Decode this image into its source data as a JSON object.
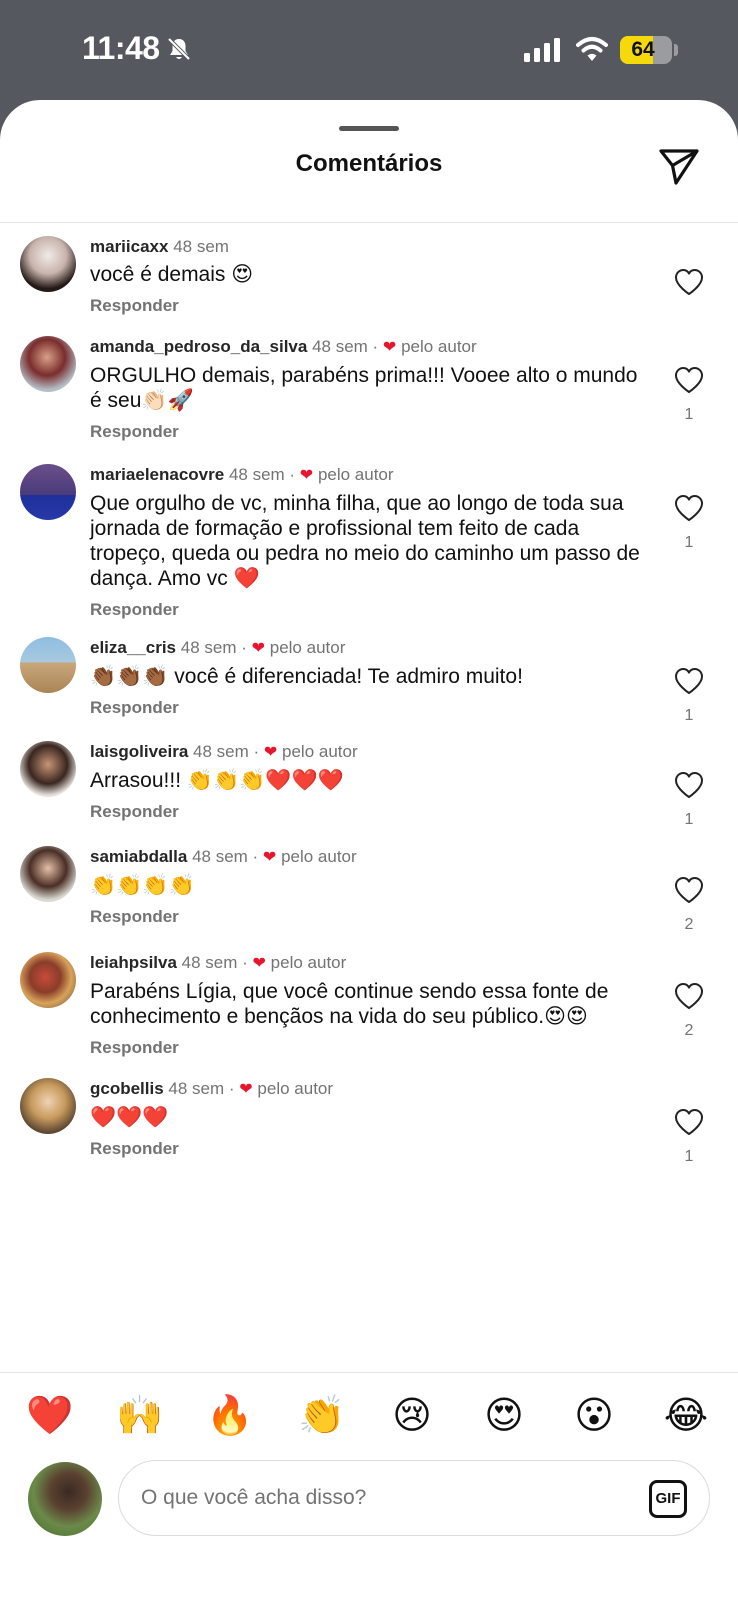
{
  "status_bar": {
    "time": "11:48",
    "battery": "64",
    "battery_level": 0.64
  },
  "header": {
    "title": "Comentários"
  },
  "comments": [
    {
      "username": "mariicaxx",
      "time": "48 sem",
      "liked_by_author": false,
      "author_label": "",
      "text": "você é demais 😍",
      "reply": "Responder",
      "likes": ""
    },
    {
      "username": "amanda_pedroso_da_silva",
      "time": "48 sem",
      "liked_by_author": true,
      "author_label": "pelo autor",
      "text": "ORGULHO demais, parabéns prima!!! Vooee alto o mundo é seu👏🏻🚀",
      "reply": "Responder",
      "likes": "1"
    },
    {
      "username": "mariaelenacovre",
      "time": "48 sem",
      "liked_by_author": true,
      "author_label": "pelo autor",
      "text": "Que orgulho de vc, minha filha, que ao longo de toda sua jornada de formação e profissional tem feito de cada tropeço, queda ou pedra no meio do caminho um passo de dança. Amo vc ❤️",
      "reply": "Responder",
      "likes": "1"
    },
    {
      "username": "eliza__cris",
      "time": "48 sem",
      "liked_by_author": true,
      "author_label": "pelo autor",
      "text": "👏🏾👏🏾👏🏾 você é diferenciada! Te admiro muito!",
      "reply": "Responder",
      "likes": "1"
    },
    {
      "username": "laisgoliveira",
      "time": "48 sem",
      "liked_by_author": true,
      "author_label": "pelo autor",
      "text": "Arrasou!!! 👏👏👏❤️❤️❤️",
      "reply": "Responder",
      "likes": "1"
    },
    {
      "username": "samiabdalla",
      "time": "48 sem",
      "liked_by_author": true,
      "author_label": "pelo autor",
      "text": "👏👏👏👏",
      "reply": "Responder",
      "likes": "2"
    },
    {
      "username": "leiahpsilva",
      "time": "48 sem",
      "liked_by_author": true,
      "author_label": "pelo autor",
      "text": "Parabéns Lígia, que você continue sendo essa fonte de conhecimento e bençãos na vida do seu público.😍😍",
      "reply": "Responder",
      "likes": "2"
    },
    {
      "username": "gcobellis",
      "time": "48 sem",
      "liked_by_author": true,
      "author_label": "pelo autor",
      "text": "❤️❤️❤️",
      "reply": "Responder",
      "likes": "1"
    }
  ],
  "reactions": [
    "❤️",
    "🙌",
    "🔥",
    "👏",
    "😢",
    "😍",
    "😮",
    "😂"
  ],
  "composer": {
    "placeholder": "O que você acha disso?",
    "gif_label": "GIF"
  },
  "colors": {
    "status_bar_bg": "#55595f",
    "author_heart": "#e8152e",
    "battery_yellow": "#f5d90a",
    "meta_gray": "#737373"
  },
  "icons": {
    "status": [
      "bell-off-icon",
      "signal-icon",
      "wifi-icon",
      "battery-icon"
    ],
    "header": "send-icon",
    "comment_like": "heart-outline-icon"
  }
}
